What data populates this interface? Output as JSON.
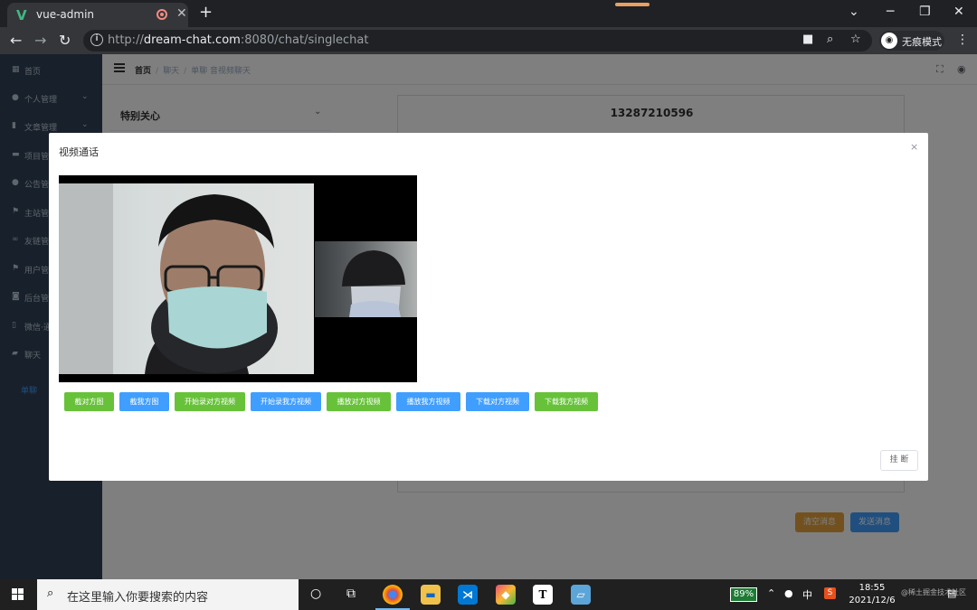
{
  "browser": {
    "tab_title": "vue-admin",
    "new_tab": "+",
    "url_prefix": "http://",
    "url_host": "dream-chat.com",
    "url_rest": ":8080/chat/singlechat",
    "incognito_label": "无痕模式"
  },
  "sidebar": {
    "items": [
      {
        "label": "首页",
        "icon": "grid-icon"
      },
      {
        "label": "个人管理",
        "icon": "user-icon"
      },
      {
        "label": "文章管理",
        "icon": "chart-icon"
      },
      {
        "label": "项目管理",
        "icon": "card-icon"
      },
      {
        "label": "公告管理",
        "icon": "pin-icon"
      },
      {
        "label": "主站管理",
        "icon": "flag-icon"
      },
      {
        "label": "友链管理",
        "icon": "link-icon"
      },
      {
        "label": "用户管理",
        "icon": "flag-icon"
      },
      {
        "label": "后台管理",
        "icon": "camera-icon"
      },
      {
        "label": "微信·通知",
        "icon": "doc-icon"
      },
      {
        "label": "聊天",
        "icon": "chat-icon"
      },
      {
        "label": "单聊",
        "icon": ""
      }
    ]
  },
  "navbar": {
    "breadcrumb": [
      "首页",
      "聊天",
      "单聊 音视频聊天"
    ]
  },
  "friends": {
    "group_title": "特别关心"
  },
  "chat": {
    "peer": "13287210596",
    "clear_button": "清空消息",
    "send_button": "发送消息",
    "clear_color": "#e6a23c",
    "send_color": "#409eff"
  },
  "dialog": {
    "title": "视频通话",
    "close": "×",
    "hangup": "挂 断",
    "buttons": [
      {
        "label": "截对方图",
        "color": "green"
      },
      {
        "label": "截我方图",
        "color": "blue"
      },
      {
        "label": "开始录对方视频",
        "color": "green"
      },
      {
        "label": "开始录我方视频",
        "color": "blue"
      },
      {
        "label": "播放对方视频",
        "color": "green"
      },
      {
        "label": "播放我方视频",
        "color": "blue"
      },
      {
        "label": "下载对方视频",
        "color": "blue"
      },
      {
        "label": "下载我方视频",
        "color": "green"
      }
    ]
  },
  "taskbar": {
    "search_placeholder": "在这里输入你要搜索的内容",
    "battery": "89%",
    "ime": "中",
    "time": "18:55",
    "date": "2021/12/6",
    "watermark": "@稀土掘金技术社区"
  }
}
